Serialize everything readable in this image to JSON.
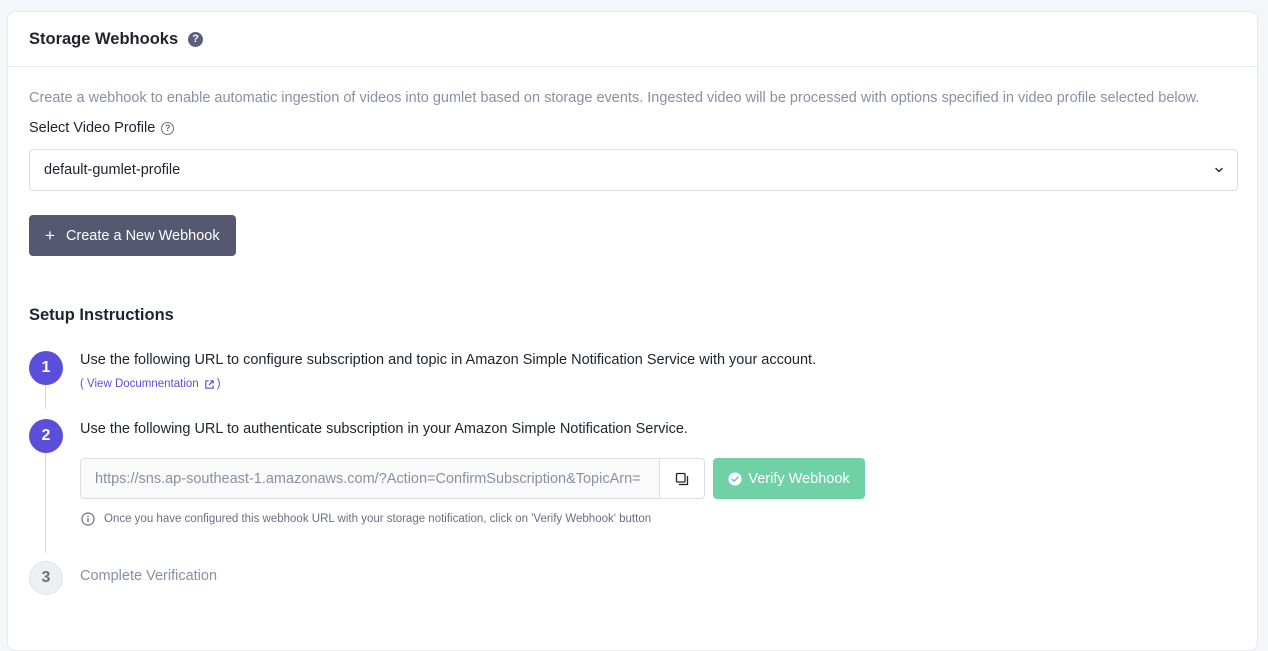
{
  "header": {
    "title": "Storage Webhooks",
    "help_icon": "question-circle-icon"
  },
  "description": "Create a webhook to enable automatic ingestion of videos into gumlet based on storage events. Ingested video will be processed with options specified in video profile selected below.",
  "video_profile": {
    "label": "Select Video Profile",
    "selected": "default-gumlet-profile"
  },
  "create_button": {
    "icon": "+",
    "label": "Create a New Webhook"
  },
  "setup": {
    "title": "Setup Instructions",
    "steps": [
      {
        "number": "1",
        "text": "Use the following URL to configure subscription and topic in Amazon Simple Notification Service with your account.",
        "link_open": "( View Documnentation",
        "link_close": ")"
      },
      {
        "number": "2",
        "text": "Use the following URL to authenticate subscription in your Amazon Simple Notification Service.",
        "url": "https://sns.ap-southeast-1.amazonaws.com/?Action=ConfirmSubscription&TopicArn=",
        "verify_label": "Verify Webhook",
        "hint": "Once you have configured this webhook URL with your storage notification, click on 'Verify Webhook' button"
      },
      {
        "number": "3",
        "text": "Complete Verification"
      }
    ]
  },
  "colors": {
    "accent": "#5b4fd9",
    "primary_button": "#555870",
    "success_button": "#6fd1a5",
    "muted_text": "#8a8fa3"
  }
}
